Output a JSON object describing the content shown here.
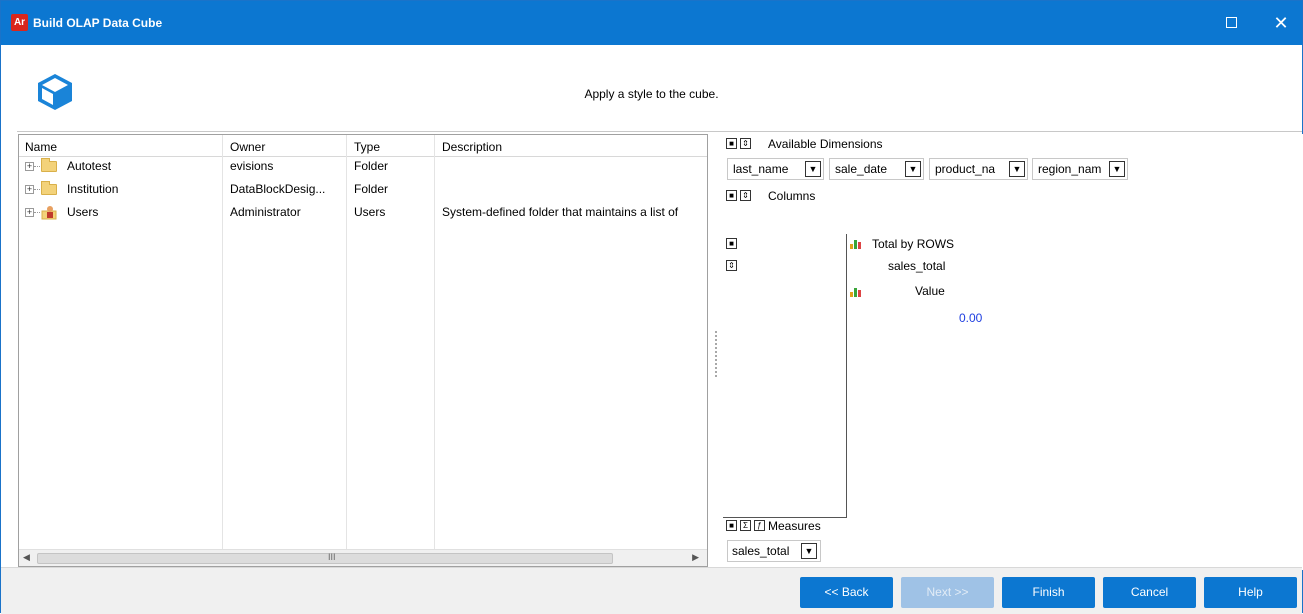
{
  "window": {
    "title": "Build OLAP Data Cube",
    "app_icon_text": "Ar",
    "accent_color": "#0c77d1"
  },
  "header": {
    "instruction": "Apply a style to the cube.",
    "icon": "cube-icon"
  },
  "grid": {
    "columns": [
      "Name",
      "Owner",
      "Type",
      "Description"
    ],
    "rows": [
      {
        "name": "Autotest",
        "owner": "evisions",
        "type": "Folder",
        "description": "",
        "icon": "folder-icon"
      },
      {
        "name": "Institution",
        "owner": "DataBlockDesig...",
        "type": "Folder",
        "description": "",
        "icon": "folder-icon"
      },
      {
        "name": "Users",
        "owner": "Administrator",
        "type": "Users",
        "description": "System-defined folder that maintains a list of",
        "icon": "users-icon"
      }
    ],
    "scroll_grip": "III"
  },
  "olap": {
    "available_dimensions_label": "Available Dimensions",
    "dimensions": [
      "last_name",
      "sale_date",
      "product_na",
      "region_nam"
    ],
    "columns_label": "Columns",
    "pivot": {
      "total_label": "Total by ROWS",
      "measure_label": "sales_total",
      "value_label": "Value",
      "value": "0.00"
    },
    "measures_label": "Measures",
    "measure_selected": "sales_total"
  },
  "footer": {
    "back": "<< Back",
    "next": "Next >>",
    "finish": "Finish",
    "cancel": "Cancel",
    "help": "Help"
  }
}
